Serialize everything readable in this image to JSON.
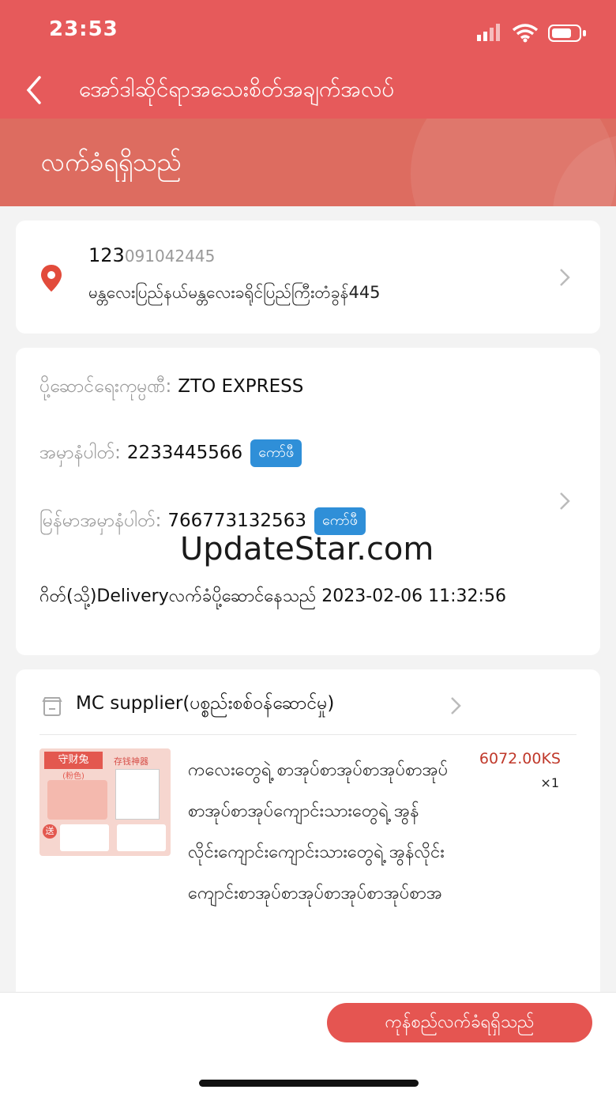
{
  "status_bar": {
    "time": "23:53"
  },
  "nav": {
    "title": "အော်ဒါဆိုင်ရာအသေးစိတ်အချက်အလပ်"
  },
  "order_status": "လက်ခံရရှိသည်",
  "address": {
    "name": "123",
    "phone": "091042445",
    "line": "မန္တလေးပြည်နယ်မန္တလေးခရိုင်ပြည်ကြီးတံခွန်445"
  },
  "shipping": {
    "company_label": "ပို့ဆောင်ရေးကုမ္ပဏီ:",
    "company_value": "ZTO EXPRESS",
    "tracking_label": "အမှာနံပါတ်:",
    "tracking_value": "2233445566",
    "mm_tracking_label": "မြန်မာအမှာနံပါတ်:",
    "mm_tracking_value": "766773132563",
    "copy_label": "ကော်ဖီ",
    "latest_event": "ဂိတ်(သို့)Deliveryလက်ခံပို့ဆောင်နေသည်  2023-02-06 11:32:56"
  },
  "watermark": "UpdateStar.com",
  "shop": {
    "name": "MC supplier(ပစ္စည်းစစ်ဝန်ဆောင်မှု)",
    "product": {
      "title": "ကလေးတွေရဲ့ စာအုပ်စာအုပ်စာအုပ်စာအုပ်စာအုပ်စာအုပ်ကျောင်းသားတွေရဲ့ အွန်လိုင်းကျောင်းကျောင်းသားတွေရဲ့ အွန်လိုင်းကျောင်းစာအုပ်စာအုပ်စာအုပ်စာအုပ်စာအ",
      "price": "6072.00KS",
      "quantity": "×1",
      "image_text_1": "守财兔",
      "image_text_2": "(粉色)",
      "image_text_3": "存钱神器",
      "image_text_4": "送"
    }
  },
  "footer": {
    "confirm_label": "ကုန်စည်လက်ခံရရှိသည်"
  },
  "colors": {
    "header": "#e65a5b",
    "band": "#dd6c60",
    "copy_button": "#2f8fd8",
    "price": "#c0392b",
    "confirm": "#e55551"
  }
}
